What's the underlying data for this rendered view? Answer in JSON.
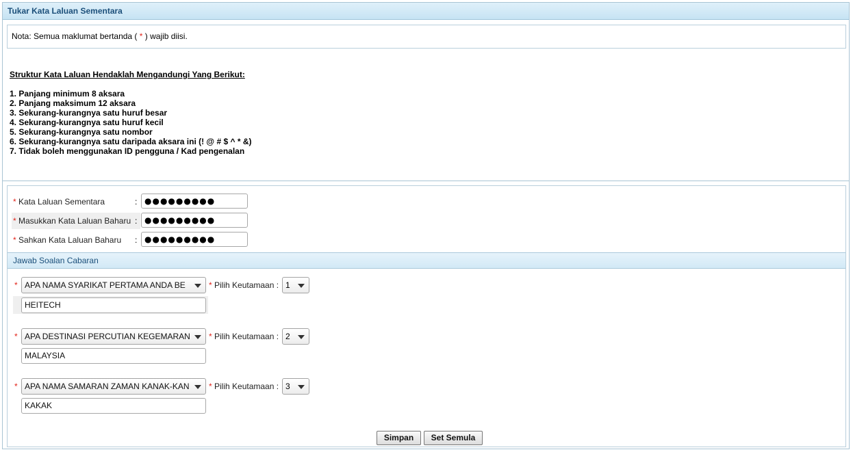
{
  "title": "Tukar Kata Laluan Sementara",
  "nota": {
    "prefix": "Nota: Semua maklumat bertanda ( ",
    "star": "*",
    "suffix": " ) wajib diisi."
  },
  "rules": {
    "heading": "Struktur Kata Laluan Hendaklah Mengandungi Yang Berikut:",
    "items": [
      "1. Panjang minimum 8 aksara",
      "2. Panjang maksimum 12 aksara",
      "3. Sekurang-kurangnya satu huruf besar",
      "4. Sekurang-kurangnya satu huruf kecil",
      "5. Sekurang-kurangnya satu nombor",
      "6. Sekurang-kurangnya satu daripada aksara ini (! @ # $ ^ * &)",
      "7. Tidak boleh menggunakan ID pengguna / Kad pengenalan"
    ]
  },
  "form": {
    "star": "*",
    "colon": ":",
    "fields": [
      {
        "label": "Kata Laluan Sementara",
        "value": "●●●●●●●●●"
      },
      {
        "label": "Masukkan Kata Laluan Baharu",
        "value": "●●●●●●●●●"
      },
      {
        "label": "Sahkan Kata Laluan Baharu",
        "value": "●●●●●●●●●"
      }
    ]
  },
  "challenge": {
    "heading": "Jawab Soalan Cabaran",
    "priority_label": "Pilih Keutamaan :",
    "questions": [
      {
        "question": "APA NAMA SYARIKAT PERTAMA ANDA BE",
        "priority": "1",
        "answer": "HEITECH"
      },
      {
        "question": "APA DESTINASI PERCUTIAN KEGEMARAN",
        "priority": "2",
        "answer": "MALAYSIA"
      },
      {
        "question": "APA NAMA SAMARAN ZAMAN KANAK-KAN",
        "priority": "3",
        "answer": "KAKAK"
      }
    ]
  },
  "buttons": {
    "save": "Simpan",
    "reset": "Set Semula"
  }
}
